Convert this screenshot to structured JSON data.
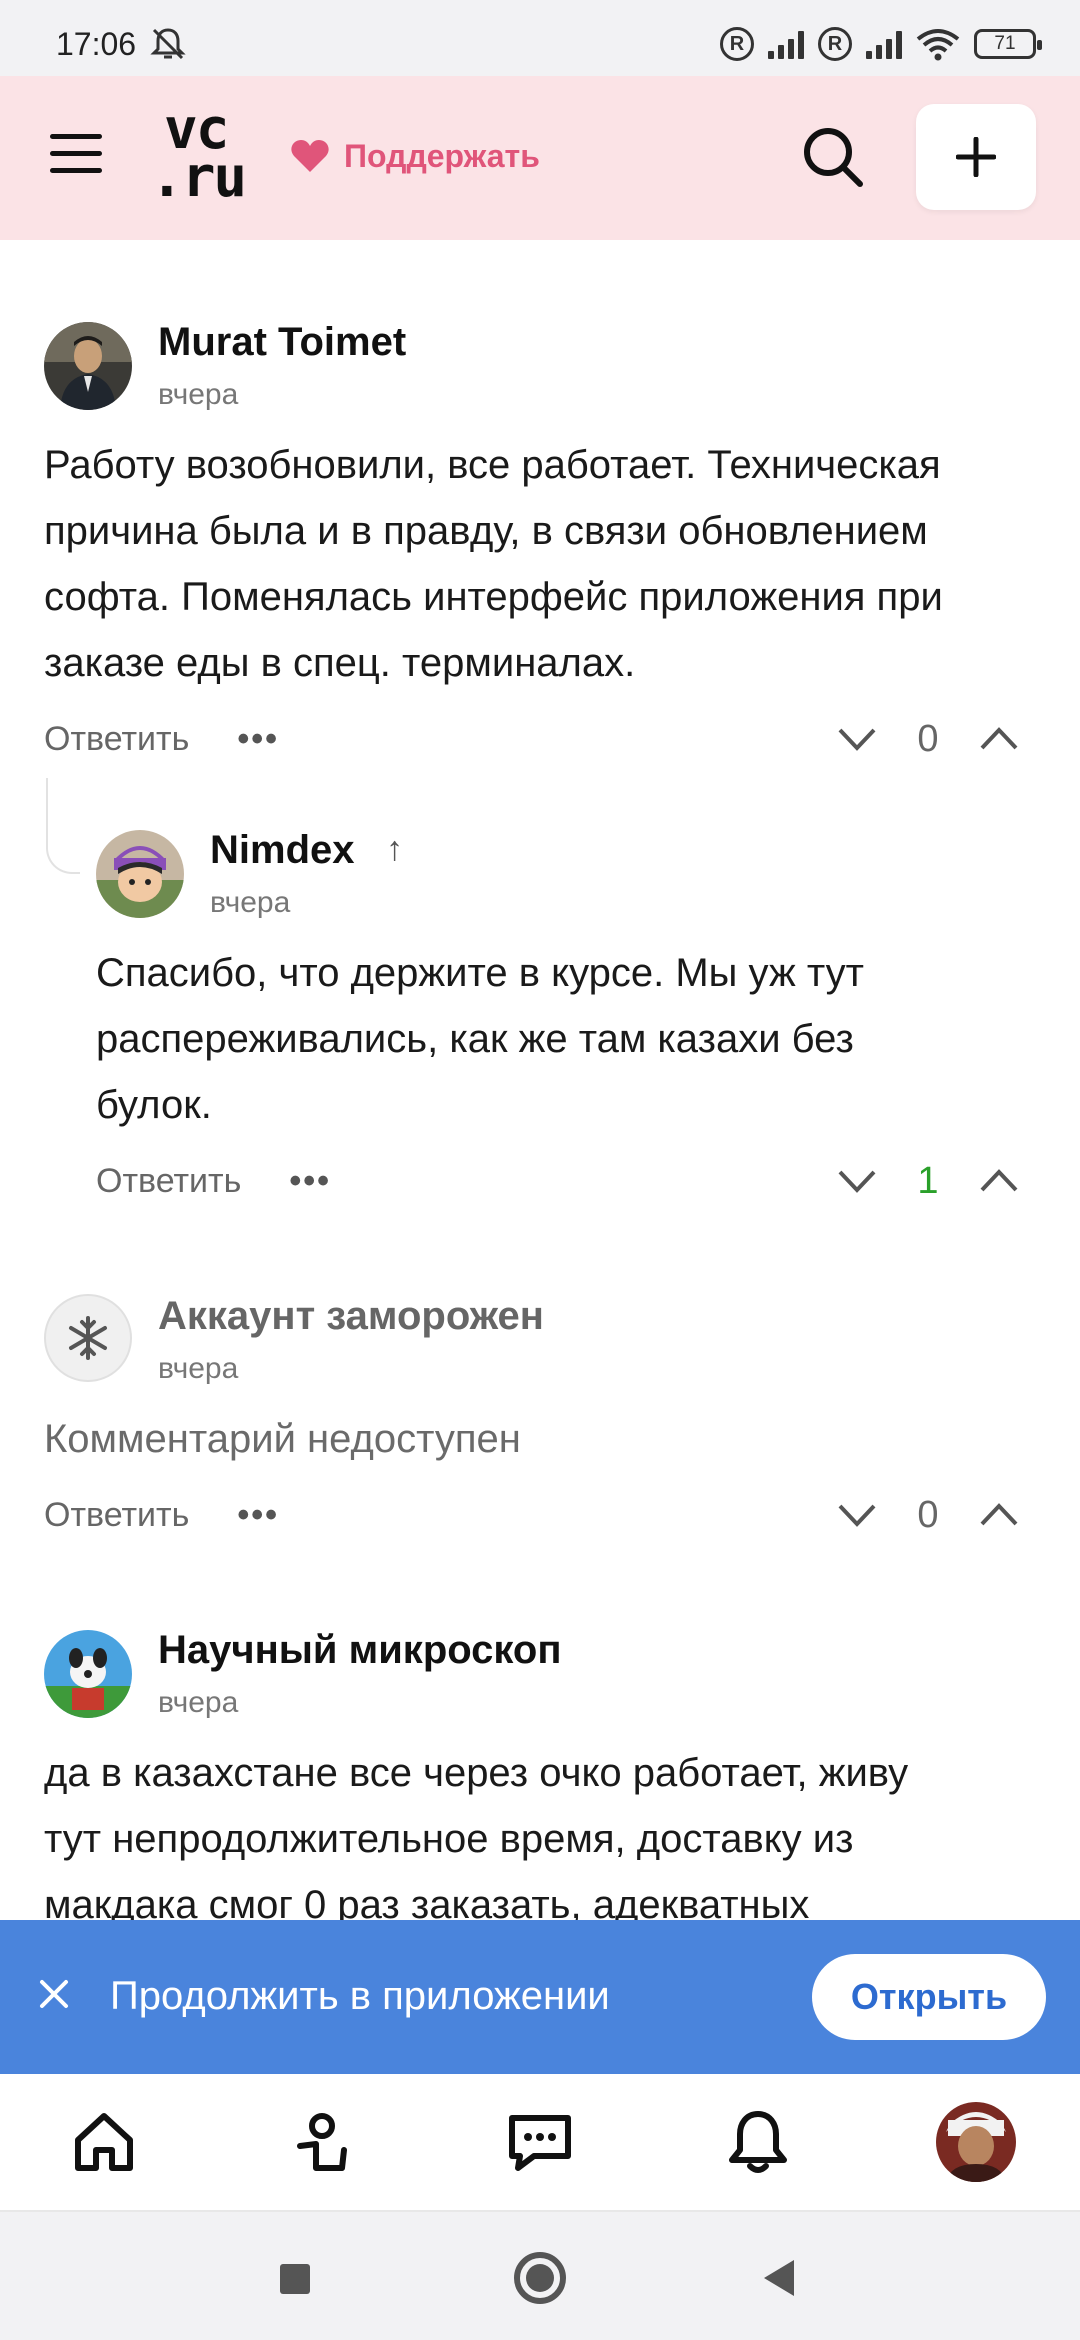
{
  "status_bar": {
    "time": "17:06",
    "battery": "71",
    "icons": [
      "mute-icon",
      "registered-icon",
      "signal-icon",
      "wifi-icon",
      "battery-icon"
    ]
  },
  "header": {
    "logo_line1": "vc",
    "logo_line2": ".ru",
    "support_label": "Поддержать",
    "icons": [
      "menu-icon",
      "heart-icon",
      "search-icon",
      "plus-icon"
    ]
  },
  "comments": [
    {
      "author": "Murat Toimet",
      "date": "вчера",
      "text_lines": [
        "Работу возобновили, все работает. Техническая",
        "причина была и в правду, в связи обновлением",
        "софта. Поменялась интерфейс приложения при",
        "заказе еды в спец. терминалах."
      ],
      "reply_label": "Ответить",
      "more_label": "•••",
      "votes": "0"
    },
    {
      "author": "Nimdex",
      "date": "вчера",
      "text_lines": [
        "Спасибо, что держите в курсе. Мы уж тут",
        "распереживались, как же там казахи без",
        "булок."
      ],
      "reply_label": "Ответить",
      "more_label": "•••",
      "votes": "1"
    },
    {
      "author": "Аккаунт заморожен",
      "date": "вчера",
      "text_lines": [
        "Комментарий недоступен"
      ],
      "reply_label": "Ответить",
      "more_label": "•••",
      "votes": "0"
    },
    {
      "author": "Научный микроскоп",
      "date": "вчера",
      "text_lines": [
        "да в казахстане все через очко работает, живу",
        "тут непродолжительное время, доставку из",
        "макдака смог 0 раз заказать, адекватных"
      ]
    }
  ],
  "app_banner": {
    "text": "Продолжить в приложении",
    "open_label": "Открыть"
  },
  "tab_bar": {
    "icons": [
      "home-icon",
      "subscriptions-icon",
      "messages-icon",
      "notifications-icon",
      "profile-avatar"
    ]
  },
  "colors": {
    "header_bg": "#fbe3e6",
    "support_pink": "#e0557a",
    "banner_blue": "#4a84dc",
    "positive_green": "#2aa02a"
  }
}
